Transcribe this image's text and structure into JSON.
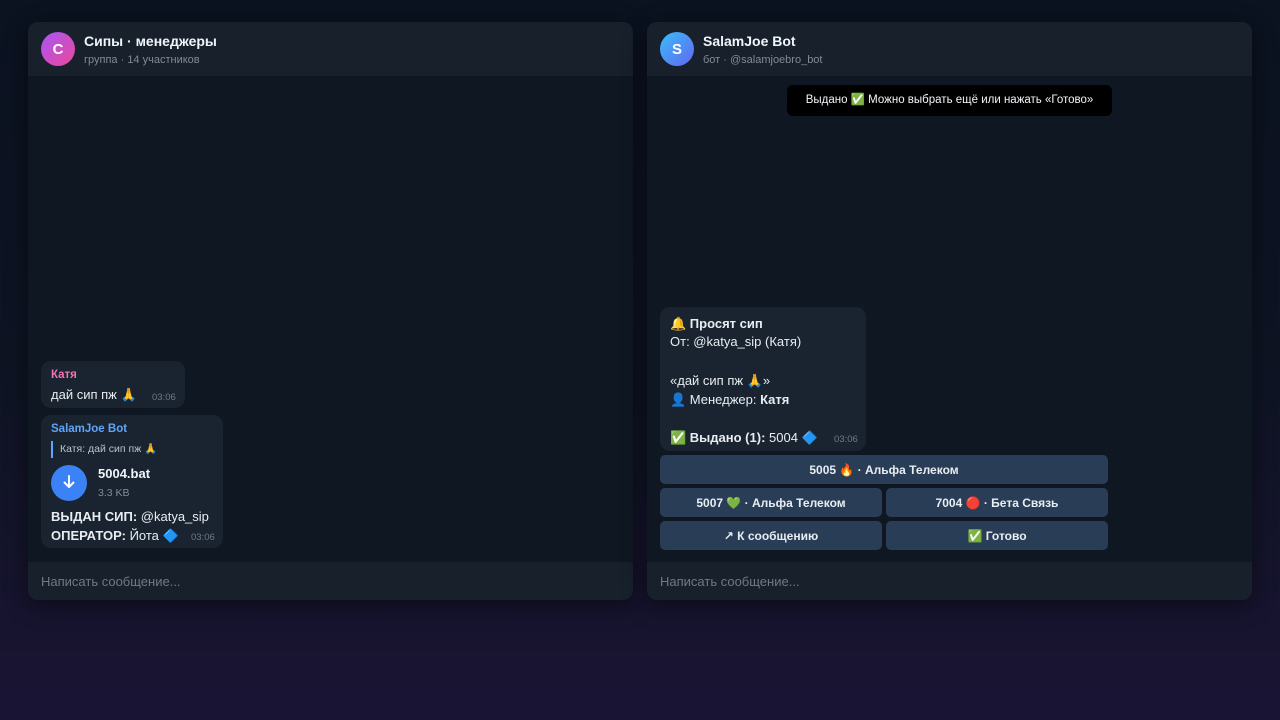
{
  "left_chat": {
    "avatar_letter": "С",
    "title": "Сипы · менеджеры",
    "subtitle": "группа · 14 участников",
    "messages": {
      "katya": {
        "sender": "Катя",
        "text": "дай сип пж 🙏",
        "time": "03:06"
      },
      "bot": {
        "sender": "SalamJoe Bot",
        "quote": "Катя: дай сип пж 🙏",
        "file_name": "5004.bat",
        "file_size": "3.3 KB",
        "line1_label": "ВЫДАН СИП:",
        "line1_value": " @katya_sip",
        "line2_label": "ОПЕРАТОР:",
        "line2_value": " Йота 🔷",
        "time": "03:06"
      }
    },
    "composer_placeholder": "Написать сообщение..."
  },
  "right_chat": {
    "avatar_letter": "S",
    "title": "SalamJoe Bot",
    "subtitle": "бот · @salamjoebro_bot",
    "toast": "Выдано ✅ Можно выбрать ещё или нажать «Готово»",
    "request": {
      "title": "🔔 Просят сип",
      "from": "От: @katya_sip (Катя)",
      "quote": "«дай сип пж 🙏»",
      "manager_label": "👤 Менеджер: ",
      "manager_name": "Катя",
      "issued_label": "✅ Выдано (1):",
      "issued_value": " 5004 🔷",
      "time": "03:06"
    },
    "keyboard": {
      "b1": "5005 🔥 · Альфа Телеком",
      "b2": "5007 💚 · Альфа Телеком",
      "b3": "7004 🔴 · Бета Связь",
      "b4": "↗ К сообщению",
      "b5": "✅ Готово"
    },
    "composer_placeholder": "Написать сообщение..."
  }
}
